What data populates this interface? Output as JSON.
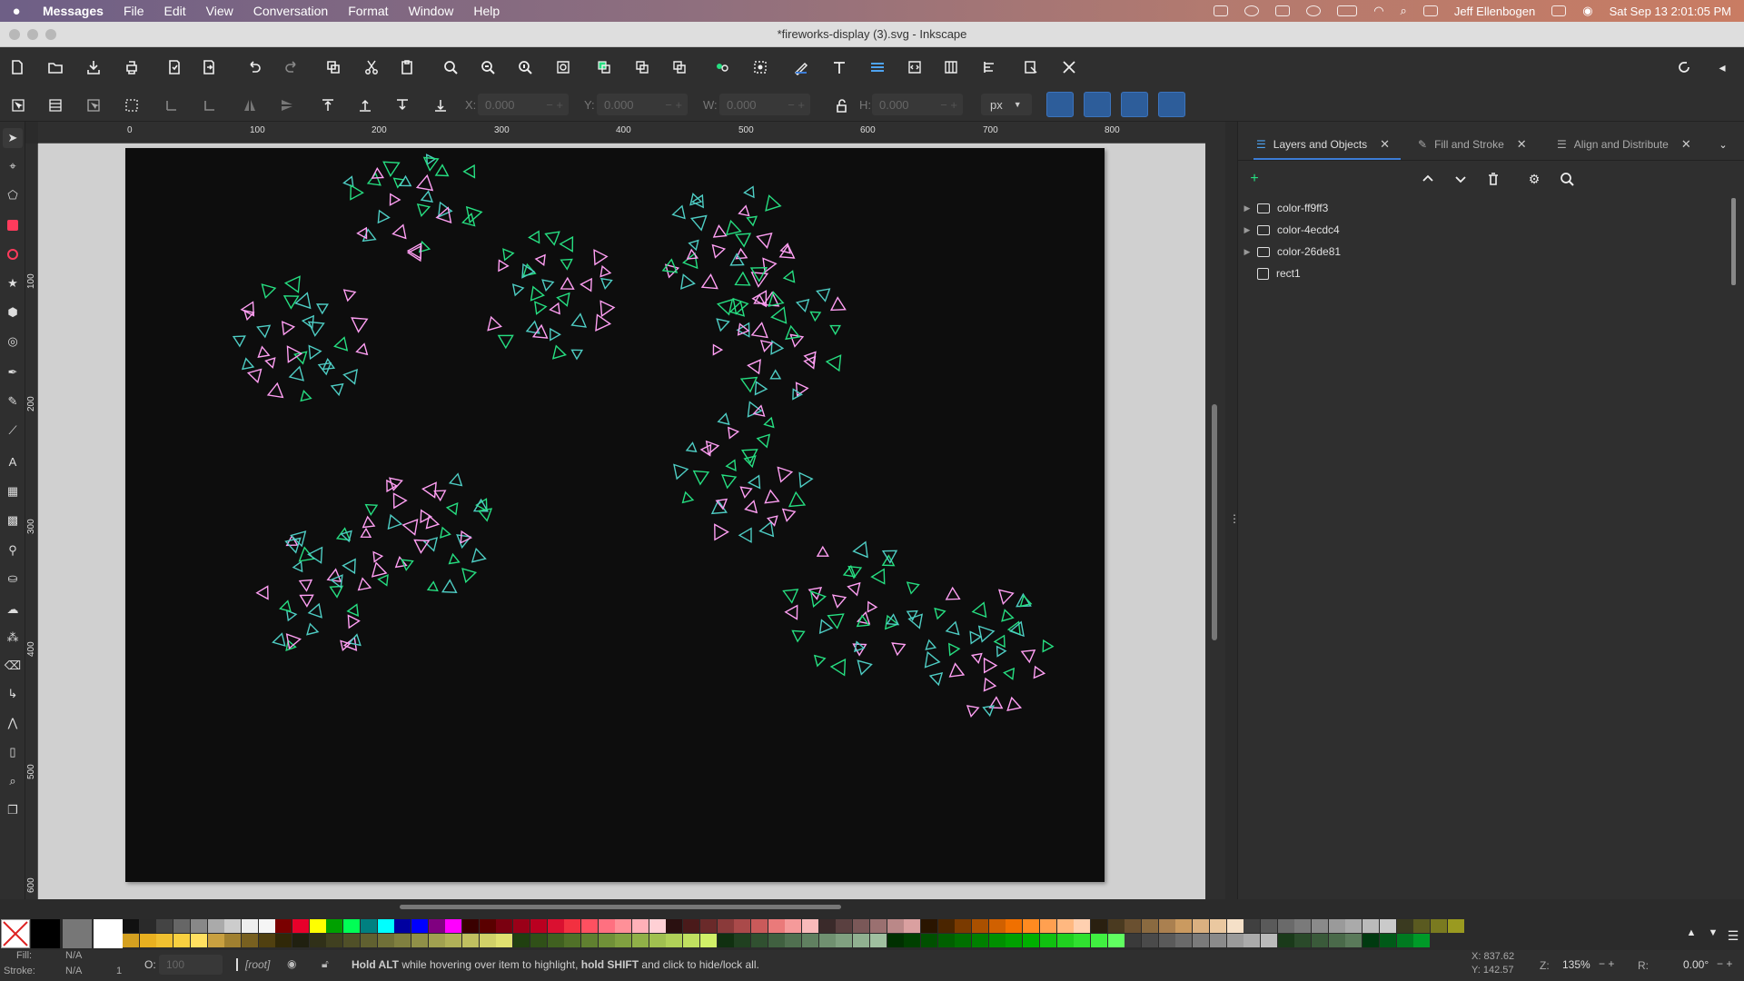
{
  "menubar": {
    "app_name": "Messages",
    "items": [
      "File",
      "Edit",
      "View",
      "Conversation",
      "Format",
      "Window",
      "Help"
    ],
    "user": "Jeff Ellenbogen",
    "datetime": "Sat Sep 13  2:01:05 PM"
  },
  "window": {
    "title": "*fireworks-display (3).svg - Inkscape"
  },
  "tool_controls": {
    "x_label": "X:",
    "x_value": "0.000",
    "y_label": "Y:",
    "y_value": "0.000",
    "w_label": "W:",
    "w_value": "0.000",
    "h_label": "H:",
    "h_value": "0.000",
    "unit": "px"
  },
  "ruler": {
    "h_labels": [
      "0",
      "100",
      "200",
      "300",
      "400",
      "500",
      "600",
      "700",
      "800"
    ],
    "v_labels": [
      "100",
      "200",
      "300",
      "400",
      "500",
      "600"
    ]
  },
  "panel": {
    "tabs": [
      {
        "label": "Layers and Objects",
        "active": true
      },
      {
        "label": "Fill and Stroke",
        "active": false
      },
      {
        "label": "Align and Distribute",
        "active": false
      }
    ],
    "layers": [
      {
        "label": "color-ff9ff3",
        "type": "group"
      },
      {
        "label": "color-4ecdc4",
        "type": "group"
      },
      {
        "label": "color-26de81",
        "type": "group"
      },
      {
        "label": "rect1",
        "type": "object"
      }
    ]
  },
  "statusbar": {
    "fill_label": "Fill:",
    "fill_value": "N/A",
    "stroke_label": "Stroke:",
    "stroke_value": "N/A",
    "stroke_width": "1",
    "opacity_label": "O:",
    "opacity_value": "100",
    "layer": "[root]",
    "message_prefix": "Hold ALT",
    "message_mid": " while hovering over item to highlight, ",
    "message_bold2": "hold SHIFT",
    "message_suffix": " and click to hide/lock all.",
    "x_coord": "X: 837.62",
    "y_coord": "Y: 142.57",
    "zoom_label": "Z:",
    "zoom_value": "135%",
    "rotation_label": "R:",
    "rotation_value": "0.00°"
  },
  "colors": {
    "pink": "#ff9ff3",
    "teal": "#4ecdc4",
    "green": "#26de81",
    "page_bg": "#0d0d0d"
  }
}
